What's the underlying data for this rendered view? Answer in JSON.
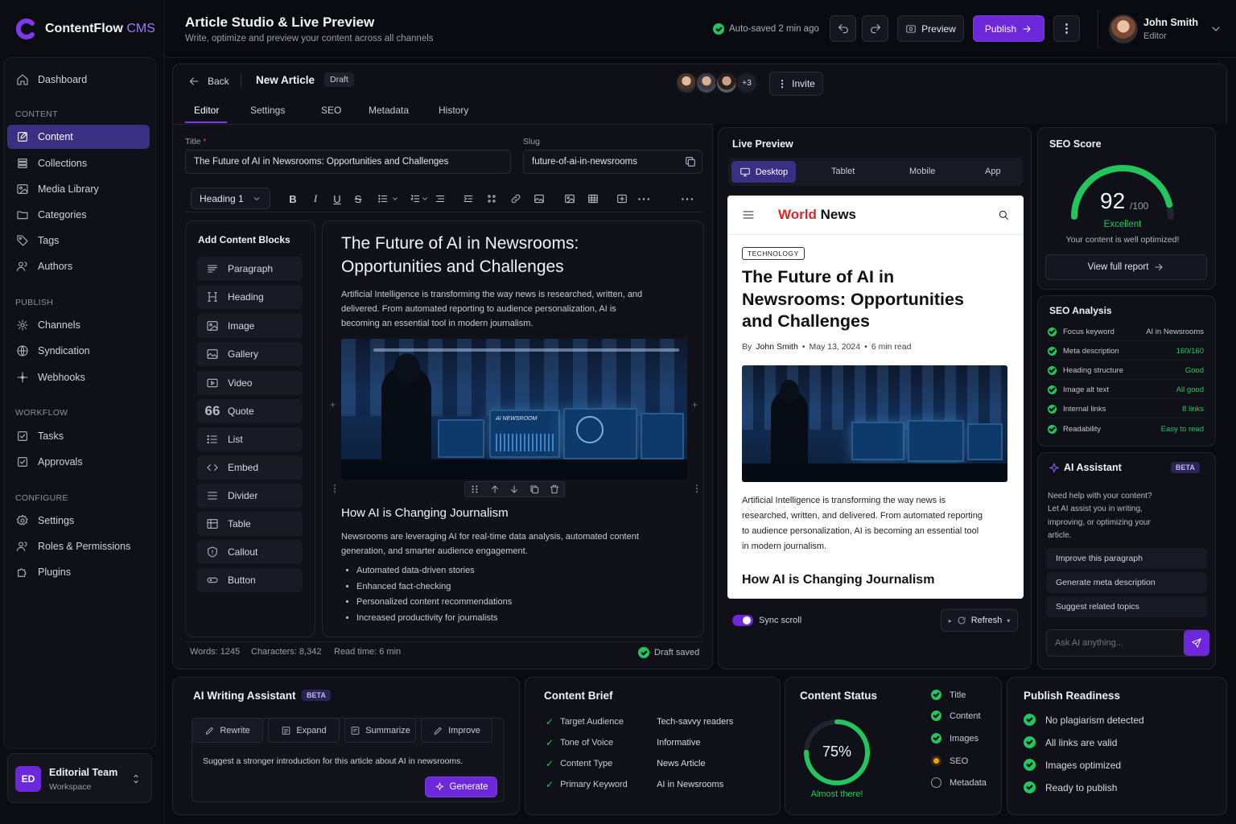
{
  "app": {
    "name": "ContentFlow",
    "name_accent": "CMS",
    "brand_color": "#7c3aed"
  },
  "sidebar": {
    "dashboard": "Dashboard",
    "sections": {
      "content": "CONTENT",
      "publish": "PUBLISH",
      "workflow": "WORKFLOW",
      "configure": "CONFIGURE"
    },
    "content_items": [
      "Content",
      "Collections",
      "Media Library",
      "Categories",
      "Tags",
      "Authors"
    ],
    "publish_items": [
      "Channels",
      "Syndication",
      "Webhooks"
    ],
    "workflow_items": [
      "Tasks",
      "Approvals"
    ],
    "configure_items": [
      "Settings",
      "Roles & Permissions",
      "Plugins"
    ],
    "workspace": {
      "initials": "ED",
      "name": "Editorial Team",
      "type": "Workspace"
    }
  },
  "header": {
    "title": "Article Studio & Live Preview",
    "subtitle": "Write, optimize and preview your content across all channels",
    "autosave": "Auto-saved 2 min ago",
    "preview_label": "Preview",
    "publish_label": "Publish",
    "user": {
      "name": "John Smith",
      "role": "Editor"
    }
  },
  "editor": {
    "back_label": "Back",
    "doc_title": "New Article",
    "status_badge": "Draft",
    "collaborators_more": "+3",
    "invite_label": "Invite",
    "tabs": [
      "Editor",
      "Settings",
      "SEO",
      "Metadata",
      "History"
    ],
    "title_label": "Title",
    "title_value": "The Future of AI in Newsrooms: Opportunities and Challenges",
    "slug_label": "Slug",
    "slug_value": "future-of-ai-in-newsrooms",
    "block_type": "Heading 1",
    "blocks_title": "Add Content Blocks",
    "blocks": [
      "Paragraph",
      "Heading",
      "Image",
      "Gallery",
      "Video",
      "Quote",
      "List",
      "Embed",
      "Divider",
      "Table",
      "Callout",
      "Button"
    ],
    "article": {
      "heading": "The Future of AI in Newsrooms: Opportunities and Challenges",
      "intro": "Artificial Intelligence is transforming the way news is researched, written, and delivered. From automated reporting to audience personalization, AI is becoming an essential tool in modern journalism.",
      "image_text_1": "AI NEWSROOM",
      "subheading": "How AI is Changing Journalism",
      "para2": "Newsrooms are leveraging AI for real-time data analysis, automated content generation, and smarter audience engagement.",
      "bullets": [
        "Automated data-driven stories",
        "Enhanced fact-checking",
        "Personalized content recommendations",
        "Increased productivity for journalists"
      ]
    },
    "footer": {
      "words": "Words: 1245",
      "characters": "Characters: 8,342",
      "read_time": "Read time: 6 min",
      "saved": "Draft saved"
    }
  },
  "preview": {
    "title": "Live Preview",
    "devices": [
      "Desktop",
      "Tablet",
      "Mobile",
      "App"
    ],
    "site_name_a": "World",
    "site_name_b": "News",
    "category": "TECHNOLOGY",
    "headline": "The Future of AI in Newsrooms: Opportunities and Challenges",
    "byline_prefix": "By",
    "author": "John Smith",
    "date": "May 13, 2024",
    "read_time": "6 min read",
    "body": "Artificial Intelligence is transforming the way news is researched, written, and delivered. From automated reporting to audience personalization, AI is becoming an essential tool in modern journalism.",
    "subheading": "How AI is Changing Journalism",
    "sync_label": "Sync scroll",
    "refresh_label": "Refresh"
  },
  "seo": {
    "title": "SEO Score",
    "score": 92,
    "score_max": "/100",
    "rating": "Excellent",
    "message": "Your content is well optimized!",
    "report_label": "View full report",
    "analysis_title": "SEO Analysis",
    "checks": [
      {
        "label": "Focus keyword",
        "value": "AI in Newsrooms"
      },
      {
        "label": "Meta description",
        "value": "160/160"
      },
      {
        "label": "Heading structure",
        "value": "Good"
      },
      {
        "label": "Image alt text",
        "value": "All good"
      },
      {
        "label": "Internal links",
        "value": "8 links"
      },
      {
        "label": "Readability",
        "value": "Easy to read"
      }
    ]
  },
  "ai_assistant": {
    "title": "AI Assistant",
    "badge": "BETA",
    "intro": "Need help with your content? Let AI assist you in writing, improving, or optimizing your article.",
    "suggestions": [
      "Improve this paragraph",
      "Generate meta description",
      "Suggest related topics"
    ],
    "input_placeholder": "Ask AI anything..."
  },
  "writing_assistant": {
    "title": "AI Writing Assistant",
    "badge": "BETA",
    "tabs": [
      "Rewrite",
      "Expand",
      "Summarize",
      "Improve"
    ],
    "prompt": "Suggest a stronger introduction for this article about AI in newsrooms.",
    "generate_label": "Generate"
  },
  "content_brief": {
    "title": "Content Brief",
    "rows": [
      {
        "label": "Target Audience",
        "value": "Tech-savvy readers"
      },
      {
        "label": "Tone of Voice",
        "value": "Informative"
      },
      {
        "label": "Content Type",
        "value": "News Article"
      },
      {
        "label": "Primary Keyword",
        "value": "AI in Newsrooms"
      }
    ]
  },
  "content_status": {
    "title": "Content Status",
    "percent": 75,
    "percent_label": "75%",
    "caption": "Almost there!",
    "items": [
      {
        "label": "Title",
        "state": "done"
      },
      {
        "label": "Content",
        "state": "done"
      },
      {
        "label": "Images",
        "state": "done"
      },
      {
        "label": "SEO",
        "state": "partial"
      },
      {
        "label": "Metadata",
        "state": "pending"
      }
    ]
  },
  "publish_readiness": {
    "title": "Publish Readiness",
    "items": [
      "No plagiarism detected",
      "All links are valid",
      "Images optimized",
      "Ready to publish"
    ]
  }
}
